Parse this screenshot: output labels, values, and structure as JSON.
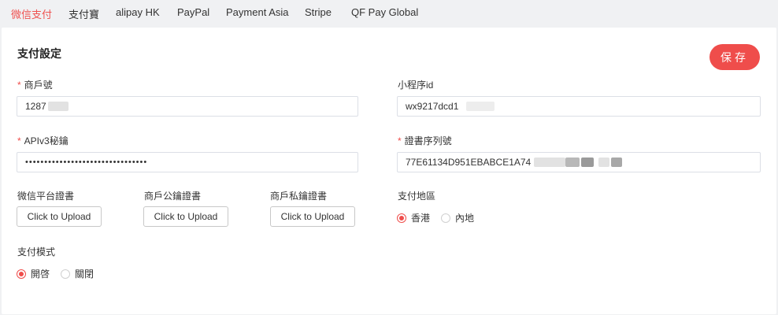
{
  "tabs": [
    "微信支付",
    "支付寶",
    "alipay HK",
    "PayPal",
    "Payment Asia",
    "Stripe",
    "QF Pay Global"
  ],
  "active_tab": "微信支付",
  "section_title": "支付設定",
  "save_label": "保存",
  "fields": {
    "merchant_no": {
      "label": "商戶號",
      "required_mark": "*",
      "value": "1287"
    },
    "mini_program_id": {
      "label": "小程序id",
      "value": "wx9217dcd1"
    },
    "apiv3_key": {
      "label": "APIv3秘鑰",
      "required_mark": "*",
      "value": "••••••••••••••••••••••••••••••••"
    },
    "cert_serial": {
      "label": "證書序列號",
      "required_mark": "*",
      "value": "77E61134D951EBABCE1A74"
    }
  },
  "uploads": [
    {
      "label": "微信平台證書",
      "button": "Click to Upload"
    },
    {
      "label": "商戶公鑰證書",
      "button": "Click to Upload"
    },
    {
      "label": "商戶私鑰證書",
      "button": "Click to Upload"
    }
  ],
  "payment_region": {
    "label": "支付地區",
    "options": [
      "香港",
      "內地"
    ],
    "selected": "香港"
  },
  "payment_mode": {
    "label": "支付模式",
    "options": [
      "開啓",
      "關閉"
    ],
    "selected": "開啓"
  },
  "colors": {
    "accent": "#ef4d4b",
    "background": "#f0f1f3",
    "card": "#ffffff"
  }
}
